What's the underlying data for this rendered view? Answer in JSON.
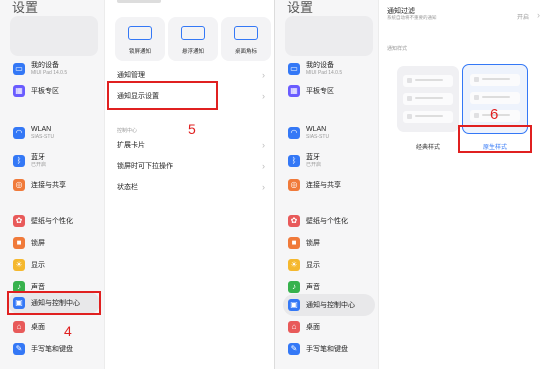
{
  "panel1": {
    "title": "设置",
    "device": {
      "label": "我的设备",
      "sub": "MIUI Pad 14.0.5"
    },
    "tablet": "平板专区",
    "wlan": {
      "label": "WLAN",
      "sub": "SIAS-STU"
    },
    "bluetooth": {
      "label": "蓝牙",
      "sub": "已开启"
    },
    "connect": "连接与共享",
    "wallpaper": "壁纸与个性化",
    "lock": "锁屏",
    "display": "显示",
    "sound": "声音",
    "notify": "通知与控制中心",
    "desktop": "桌面",
    "pen": "手写笔和键盘",
    "step": "4"
  },
  "panel2": {
    "cards": [
      "锁屏通知",
      "悬浮通知",
      "桌面角标"
    ],
    "manage": "通知管理",
    "display_settings": "通知显示设置",
    "section": "控制中心",
    "ext_cards": "扩展卡片",
    "lockscreen_pull": "锁屏时可下拉操作",
    "statusbar": "状态栏",
    "step": "5"
  },
  "panel3": {
    "title": "设置",
    "device": {
      "label": "我的设备",
      "sub": "MIUI Pad 14.0.5"
    },
    "tablet": "平板专区",
    "wlan": {
      "label": "WLAN",
      "sub": "SIAS-STU"
    },
    "bluetooth": {
      "label": "蓝牙",
      "sub": "已开启"
    },
    "connect": "连接与共享",
    "wallpaper": "壁纸与个性化",
    "lock": "锁屏",
    "display": "显示",
    "sound": "声音",
    "notify": "通知与控制中心",
    "desktop": "桌面",
    "pen": "手写笔和键盘"
  },
  "panel4": {
    "filter_title": "通知过滤",
    "filter_sub": "系统自动将不重要的通知",
    "filter_value": "开启",
    "section": "通知样式",
    "classic": "经典样式",
    "new_style": "原生样式",
    "step": "6"
  },
  "colors": {
    "accent": "#3478f6",
    "red": "#e02020"
  }
}
